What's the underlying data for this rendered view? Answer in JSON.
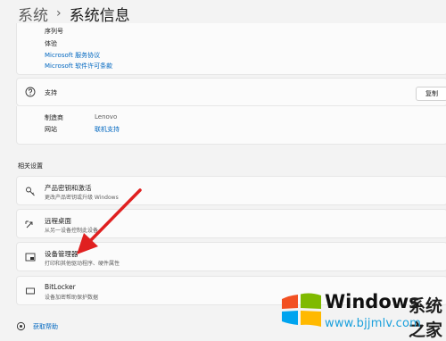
{
  "breadcrumb": {
    "root": "系统",
    "separator": "›",
    "current": "系统信息"
  },
  "specs_card": {
    "serial_label": "序列号",
    "edition_label": "体验",
    "service_agreement_link": "Microsoft 服务协议",
    "license_terms_link": "Microsoft 软件许可条款"
  },
  "support": {
    "title": "支持",
    "copy_button": "复制",
    "manufacturer_label": "制造商",
    "manufacturer_value": "Lenovo",
    "website_label": "网站",
    "website_value": "联机支持"
  },
  "related": {
    "section_title": "相关设置",
    "items": [
      {
        "title": "产品密钥和激活",
        "subtitle": "更改产品密钥或升级 Windows",
        "icon": "key-icon"
      },
      {
        "title": "远程桌面",
        "subtitle": "从另一设备控制此设备",
        "icon": "remote-desktop-icon"
      },
      {
        "title": "设备管理器",
        "subtitle": "打印和其他驱动程序、硬件属性",
        "icon": "device-manager-icon"
      },
      {
        "title": "BitLocker",
        "subtitle": "设备加密帮助保护数据",
        "icon": "bitlocker-icon"
      }
    ]
  },
  "help": {
    "label": "获取帮助"
  },
  "annotation": {
    "arrow_color": "#e02020"
  },
  "watermark": {
    "brand": "Windows",
    "cn": "系统之家",
    "url": "www.bjjmlv.com"
  },
  "colors": {
    "link": "#0067c0",
    "background": "#f3f3f3",
    "card": "#fbfbfb"
  }
}
